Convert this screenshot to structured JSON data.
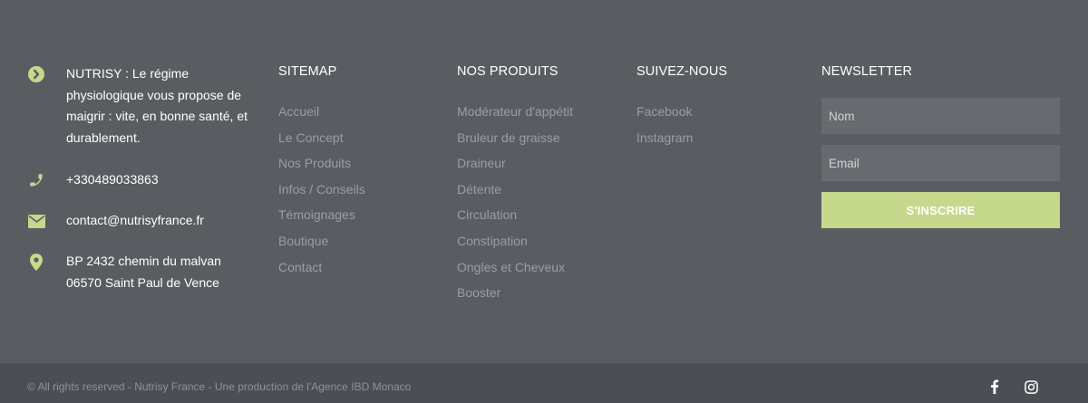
{
  "contact": {
    "about": "NUTRISY : Le régime physiologique vous propose de maigrir : vite, en bonne santé, et durablement.",
    "phone": "+330489033863",
    "email": "contact@nutrisyfrance.fr",
    "address_line1": "BP 2432 chemin du malvan",
    "address_line2": "06570 Saint Paul de Vence",
    "icon_color": "#c5d88c"
  },
  "sitemap": {
    "title": "SITEMAP",
    "links": [
      "Accueil",
      "Le Concept",
      "Nos Produits",
      "Infos / Conseils",
      "Témoignages",
      "Boutique",
      "Contact"
    ]
  },
  "products": {
    "title": "NOS PRODUITS",
    "links": [
      "Modérateur d'appétit",
      "Bruleur de graisse",
      "Draineur",
      "Détente",
      "Circulation",
      "Constipation",
      "Ongles et Cheveux",
      "Booster"
    ]
  },
  "follow": {
    "title": "SUIVEZ-NOUS",
    "links": [
      "Facebook",
      "Instagram"
    ]
  },
  "newsletter": {
    "title": "NEWSLETTER",
    "name_placeholder": "Nom",
    "email_placeholder": "Email",
    "button_label": "S'INSCRIRE",
    "button_color": "#c5d88c"
  },
  "bottom": {
    "copyright": "© All rights reserved - Nutrisy France - Une production de l'Agence IBD Monaco",
    "social_icons": [
      "facebook-icon",
      "instagram-icon"
    ]
  },
  "colors": {
    "background": "#595d62",
    "bottom_bar": "#4b4f55",
    "link": "#9a9ea3"
  }
}
